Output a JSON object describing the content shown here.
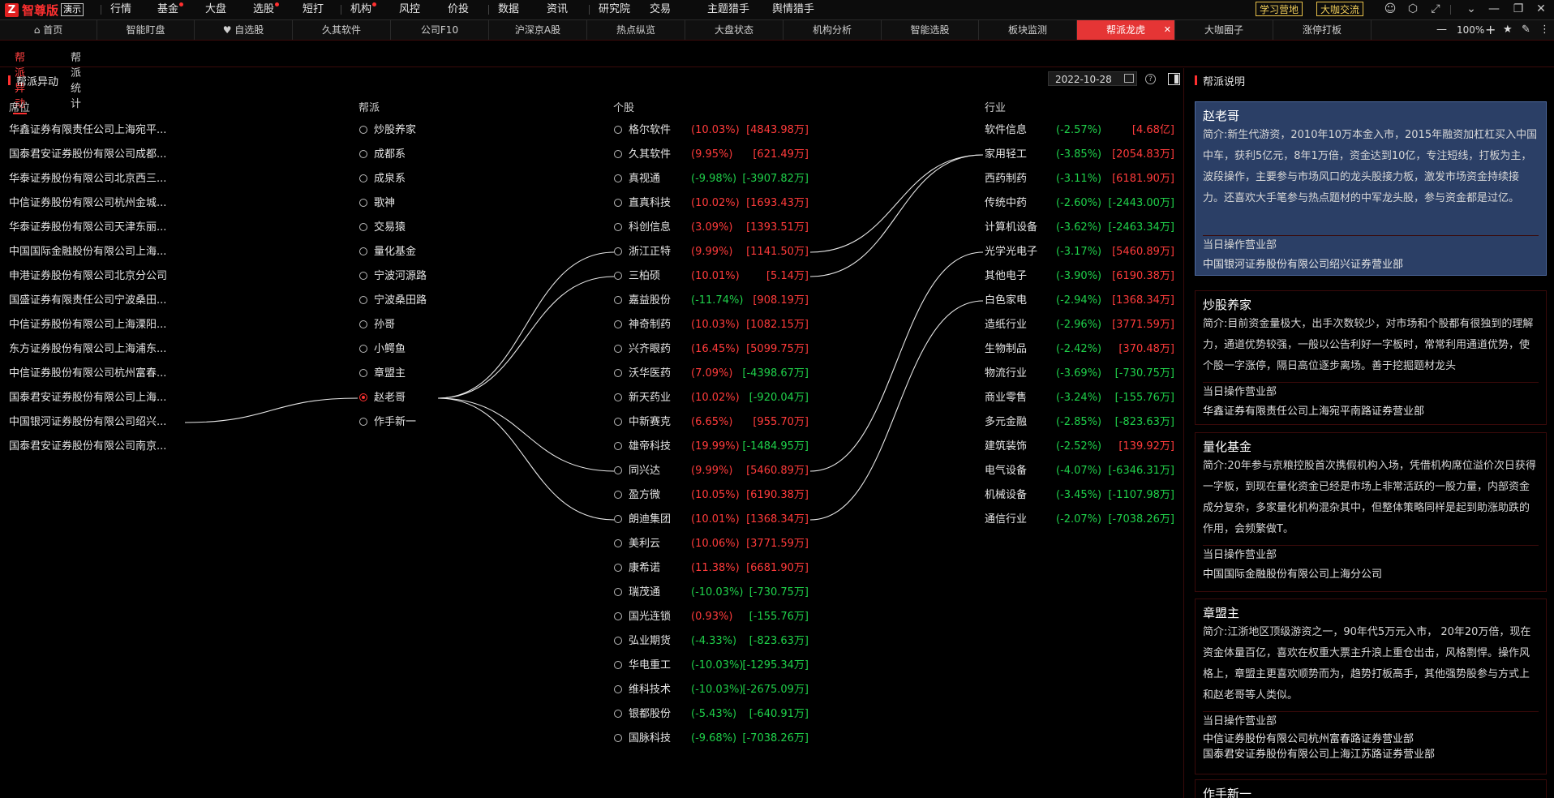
{
  "app": {
    "name": "智尊版",
    "demo": "演示",
    "logo_char": "Z"
  },
  "menu": [
    {
      "label": "行情",
      "dot": false
    },
    {
      "label": "基金",
      "dot": true
    },
    {
      "label": "大盘",
      "dot": false
    },
    {
      "label": "选股",
      "dot": true
    },
    {
      "label": "短打",
      "dot": false
    },
    {
      "label": "机构",
      "dot": true
    },
    {
      "label": "风控",
      "dot": false
    },
    {
      "label": "价投",
      "dot": false
    },
    {
      "label": "数据",
      "dot": false
    },
    {
      "label": "资讯",
      "dot": false
    },
    {
      "label": "研究院",
      "dot": false
    },
    {
      "label": "交易",
      "dot": false
    },
    {
      "label": "主题猎手",
      "dot": false
    },
    {
      "label": "舆情猎手",
      "dot": false
    }
  ],
  "badges": [
    "学习营地",
    "大咖交流"
  ],
  "window_icons": [
    "user-icon",
    "settings-icon",
    "shrink-icon",
    "minimize-icon",
    "minus-icon",
    "restore-icon",
    "close-icon"
  ],
  "tabs": [
    {
      "label": "首页",
      "icon": "home-icon"
    },
    {
      "label": "智能盯盘"
    },
    {
      "label": "自选股",
      "icon": "heart-icon"
    },
    {
      "label": "久其软件"
    },
    {
      "label": "公司F10"
    },
    {
      "label": "沪深京A股"
    },
    {
      "label": "热点纵览"
    },
    {
      "label": "大盘状态"
    },
    {
      "label": "机构分析"
    },
    {
      "label": "智能选股"
    },
    {
      "label": "板块监测"
    },
    {
      "label": "帮派龙虎",
      "active": true
    },
    {
      "label": "大咖圈子"
    },
    {
      "label": "涨停打板"
    }
  ],
  "zoom": "100%",
  "subtabs": [
    "帮派异动",
    "帮派统计"
  ],
  "section_title": "帮派异动",
  "date": "2022-10-28",
  "right_title": "帮派说明",
  "headers": {
    "seat": "席位",
    "gang": "帮派",
    "stock": "个股",
    "industry": "行业"
  },
  "seats": [
    "华鑫证券有限责任公司上海宛平...",
    "国泰君安证券股份有限公司成都...",
    "华泰证券股份有限公司北京西三...",
    "中信证券股份有限公司杭州金城...",
    "华泰证券股份有限公司天津东丽...",
    "中国国际金融股份有限公司上海...",
    "申港证券股份有限公司北京分公司",
    "国盛证券有限责任公司宁波桑田...",
    "中信证券股份有限公司上海溧阳...",
    "东方证券股份有限公司上海浦东...",
    "中信证券股份有限公司杭州富春...",
    "国泰君安证券股份有限公司上海...",
    "中国银河证券股份有限公司绍兴...",
    "国泰君安证券股份有限公司南京..."
  ],
  "gangs": [
    "炒股养家",
    "成都系",
    "成泉系",
    "歌神",
    "交易猿",
    "量化基金",
    "宁波河源路",
    "宁波桑田路",
    "孙哥",
    "小鳄鱼",
    "章盟主",
    "赵老哥",
    "作手新一"
  ],
  "selected_gang": 11,
  "stocks": [
    {
      "name": "格尔软件",
      "pct": "(10.03%)",
      "amt": "[4843.98万]",
      "up": true
    },
    {
      "name": "久其软件",
      "pct": "(9.95%)",
      "amt": "[621.49万]",
      "up": true
    },
    {
      "name": "真视通",
      "pct": "(-9.98%)",
      "amt": "[-3907.82万]",
      "up": false
    },
    {
      "name": "直真科技",
      "pct": "(10.02%)",
      "amt": "[1693.43万]",
      "up": true
    },
    {
      "name": "科创信息",
      "pct": "(3.09%)",
      "amt": "[1393.51万]",
      "up": true
    },
    {
      "name": "浙江正特",
      "pct": "(9.99%)",
      "amt": "[1141.50万]",
      "up": true
    },
    {
      "name": "三柏硕",
      "pct": "(10.01%)",
      "amt": "[5.14万]",
      "up": true
    },
    {
      "name": "嘉益股份",
      "pct": "(-11.74%)",
      "amt": "[908.19万]",
      "up": true
    },
    {
      "name": "神奇制药",
      "pct": "(10.03%)",
      "amt": "[1082.15万]",
      "up": true
    },
    {
      "name": "兴齐眼药",
      "pct": "(16.45%)",
      "amt": "[5099.75万]",
      "up": true
    },
    {
      "name": "沃华医药",
      "pct": "(7.09%)",
      "amt": "[-4398.67万]",
      "up": false
    },
    {
      "name": "新天药业",
      "pct": "(10.02%)",
      "amt": "[-920.04万]",
      "up": false
    },
    {
      "name": "中新赛克",
      "pct": "(6.65%)",
      "amt": "[955.70万]",
      "up": true
    },
    {
      "name": "雄帝科技",
      "pct": "(19.99%)",
      "amt": "[-1484.95万]",
      "up": false
    },
    {
      "name": "同兴达",
      "pct": "(9.99%)",
      "amt": "[5460.89万]",
      "up": true
    },
    {
      "name": "盈方微",
      "pct": "(10.05%)",
      "amt": "[6190.38万]",
      "up": true
    },
    {
      "name": "朗迪集团",
      "pct": "(10.01%)",
      "amt": "[1368.34万]",
      "up": true
    },
    {
      "name": "美利云",
      "pct": "(10.06%)",
      "amt": "[3771.59万]",
      "up": true
    },
    {
      "name": "康希诺",
      "pct": "(11.38%)",
      "amt": "[6681.90万]",
      "up": true
    },
    {
      "name": "瑞茂通",
      "pct": "(-10.03%)",
      "amt": "[-730.75万]",
      "up": false
    },
    {
      "name": "国光连锁",
      "pct": "(0.93%)",
      "amt": "[-155.76万]",
      "up": false
    },
    {
      "name": "弘业期货",
      "pct": "(-4.33%)",
      "amt": "[-823.63万]",
      "up": false
    },
    {
      "name": "华电重工",
      "pct": "(-10.03%)",
      "amt": "[-1295.34万]",
      "up": false
    },
    {
      "name": "维科技术",
      "pct": "(-10.03%)",
      "amt": "[-2675.09万]",
      "up": false
    },
    {
      "name": "银都股份",
      "pct": "(-5.43%)",
      "amt": "[-640.91万]",
      "up": false
    },
    {
      "name": "国脉科技",
      "pct": "(-9.68%)",
      "amt": "[-7038.26万]",
      "up": false
    }
  ],
  "industries": [
    {
      "name": "软件信息",
      "pct": "(-2.57%)",
      "amt": "[4.68亿]",
      "up": true
    },
    {
      "name": "家用轻工",
      "pct": "(-3.85%)",
      "amt": "[2054.83万]",
      "up": true
    },
    {
      "name": "西药制药",
      "pct": "(-3.11%)",
      "amt": "[6181.90万]",
      "up": true
    },
    {
      "name": "传统中药",
      "pct": "(-2.60%)",
      "amt": "[-2443.00万]",
      "up": false
    },
    {
      "name": "计算机设备",
      "pct": "(-3.62%)",
      "amt": "[-2463.34万]",
      "up": false
    },
    {
      "name": "光学光电子",
      "pct": "(-3.17%)",
      "amt": "[5460.89万]",
      "up": true
    },
    {
      "name": "其他电子",
      "pct": "(-3.90%)",
      "amt": "[6190.38万]",
      "up": true
    },
    {
      "name": "白色家电",
      "pct": "(-2.94%)",
      "amt": "[1368.34万]",
      "up": true
    },
    {
      "name": "造纸行业",
      "pct": "(-2.96%)",
      "amt": "[3771.59万]",
      "up": true
    },
    {
      "name": "生物制品",
      "pct": "(-2.42%)",
      "amt": "[370.48万]",
      "up": true
    },
    {
      "name": "物流行业",
      "pct": "(-3.69%)",
      "amt": "[-730.75万]",
      "up": false
    },
    {
      "name": "商业零售",
      "pct": "(-3.24%)",
      "amt": "[-155.76万]",
      "up": false
    },
    {
      "name": "多元金融",
      "pct": "(-2.85%)",
      "amt": "[-823.63万]",
      "up": false
    },
    {
      "name": "建筑装饰",
      "pct": "(-2.52%)",
      "amt": "[139.92万]",
      "up": true
    },
    {
      "name": "电气设备",
      "pct": "(-4.07%)",
      "amt": "[-6346.31万]",
      "up": false
    },
    {
      "name": "机械设备",
      "pct": "(-3.45%)",
      "amt": "[-1107.98万]",
      "up": false
    },
    {
      "name": "通信行业",
      "pct": "(-2.07%)",
      "amt": "[-7038.26万]",
      "up": false
    }
  ],
  "links": {
    "seat_to_gang": [
      12,
      11
    ],
    "gang_to_stock": [
      [
        11,
        5
      ],
      [
        11,
        6
      ],
      [
        11,
        14
      ],
      [
        11,
        16
      ]
    ],
    "stock_to_industry": [
      [
        5,
        1
      ],
      [
        6,
        1
      ],
      [
        14,
        5
      ],
      [
        16,
        7
      ]
    ]
  },
  "gang_cards": [
    {
      "name": "赵老哥",
      "intro": "简介:新生代游资，2010年10万本金入市，2015年融资加杠杠买入中国中车，获利5亿元，8年1万倍，资金达到10亿，专注短线，打板为主，波段操作，主要参与市场风口的龙头股接力板，激发市场资金持续接力。还喜欢大手笔参与热点题材的中军龙头股，参与资金都是过亿。",
      "ops_label": "当日操作营业部",
      "ops": [
        "中国银河证券股份有限公司绍兴证券营业部"
      ],
      "selected": true
    },
    {
      "name": "炒股养家",
      "intro": "简介:目前资金量极大，出手次数较少，对市场和个股都有很独到的理解力，通道优势较强，一般以公告利好一字板时，常常利用通道优势，使个股一字涨停，隔日高位逐步离场。善于挖掘题材龙头",
      "ops_label": "当日操作营业部",
      "ops": [
        "华鑫证券有限责任公司上海宛平南路证券营业部"
      ]
    },
    {
      "name": "量化基金",
      "intro": "简介:20年参与京粮控股首次携假机构入场，凭借机构席位溢价次日获得一字板，到现在量化资金已经是市场上非常活跃的一股力量，内部资金成分复杂，多家量化机构混杂其中，但整体策略同样是起到助涨助跌的作用，会频繁做T。",
      "ops_label": "当日操作营业部",
      "ops": [
        "中国国际金融股份有限公司上海分公司"
      ]
    },
    {
      "name": "章盟主",
      "intro": "简介:江浙地区顶级游资之一，90年代5万元入市， 20年20万倍，现在资金体量百亿，喜欢在权重大票主升浪上重仓出击，风格剽悍。操作风格上，章盟主更喜欢顺势而为，趋势打板高手，其他强势股参与方式上和赵老哥等人类似。",
      "ops_label": "当日操作营业部",
      "ops": [
        "中信证券股份有限公司杭州富春路证券营业部",
        "国泰君安证券股份有限公司上海江苏路证券营业部"
      ]
    },
    {
      "name": "作手新一",
      "intro": "",
      "ops_label": "",
      "ops": []
    }
  ]
}
